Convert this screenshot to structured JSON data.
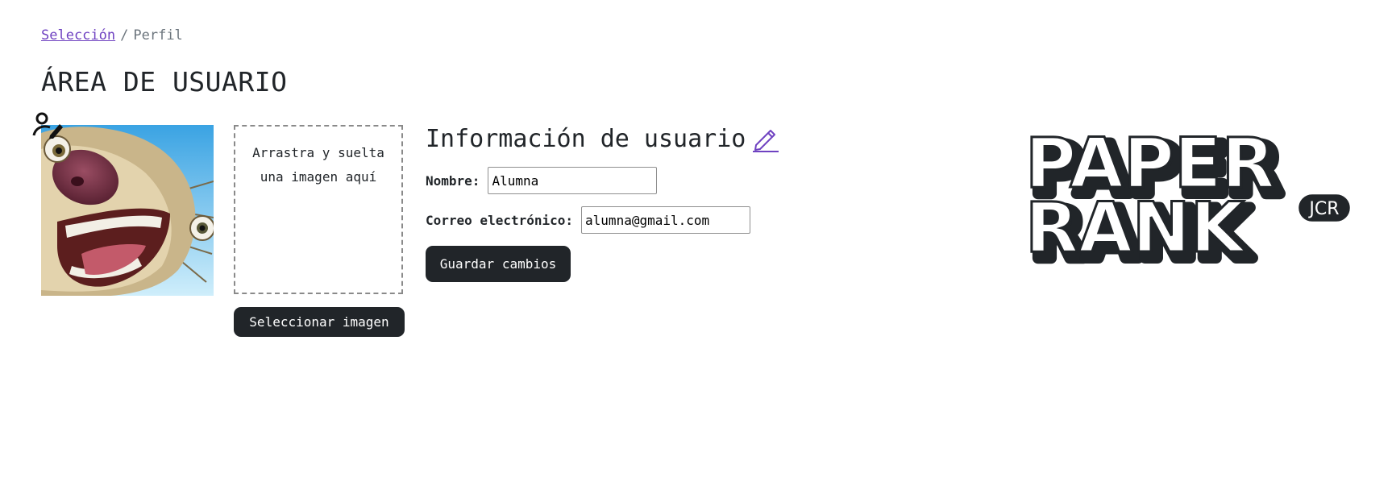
{
  "breadcrumb": {
    "link_label": "Selección",
    "separator": "/",
    "current": "Perfil"
  },
  "page_title": "ÁREA DE USUARIO",
  "avatar": {
    "icon": "user-pen-icon"
  },
  "dropzone": {
    "line1": "Arrastra y suelta",
    "line2": "una imagen aquí"
  },
  "select_image_label": "Seleccionar imagen",
  "info": {
    "title": "Información de usuario",
    "edit_icon": "pencil-icon",
    "name_label": "Nombre:",
    "name_value": "Alumna",
    "email_label": "Correo electrónico:",
    "email_value": "alumna@gmail.com",
    "save_label": "Guardar cambios"
  },
  "logo": {
    "line1": "PAPER",
    "line2": "RANK",
    "badge": "JCR"
  },
  "colors": {
    "accent": "#6f42c1",
    "dark": "#212529",
    "muted": "#6c757d"
  }
}
